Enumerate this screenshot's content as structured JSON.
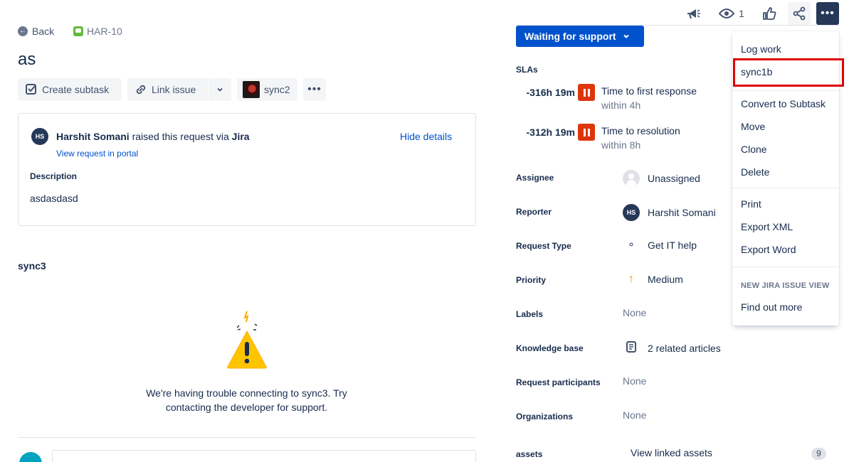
{
  "breadcrumb": {
    "back_label": "Back",
    "issue_key": "HAR-10"
  },
  "issue": {
    "title": "as"
  },
  "toolbar": {
    "create_subtask": "Create subtask",
    "link_issue": "Link issue",
    "app_label": "sync2"
  },
  "request": {
    "reporter_name": "Harshit Somani",
    "raised_text": "raised this request via",
    "channel": "Jira",
    "hide_details": "Hide details",
    "view_portal": "View request in portal",
    "description_label": "Description",
    "description": "asdasdasd",
    "avatar_initials": "HS"
  },
  "app_panel": {
    "title": "sync3",
    "error_line1": "We're having trouble connecting to sync3. Try",
    "error_line2": "contacting the developer for support."
  },
  "header": {
    "watchers": "1"
  },
  "status": {
    "label": "Waiting for support"
  },
  "slas": {
    "title": "SLAs",
    "items": [
      {
        "time": "-316h 19m",
        "name": "Time to first response",
        "goal": "within 4h"
      },
      {
        "time": "-312h 19m",
        "name": "Time to resolution",
        "goal": "within 8h"
      }
    ]
  },
  "fields": {
    "assignee_label": "Assignee",
    "assignee": "Unassigned",
    "reporter_label": "Reporter",
    "reporter": "Harshit Somani",
    "request_type_label": "Request Type",
    "request_type": "Get IT help",
    "priority_label": "Priority",
    "priority": "Medium",
    "labels_label": "Labels",
    "labels": "None",
    "kb_label": "Knowledge base",
    "kb": "2 related articles",
    "participants_label": "Request participants",
    "participants": "None",
    "orgs_label": "Organizations",
    "orgs": "None",
    "assets_label": "assets",
    "assets": "View linked assets",
    "assets_count": "9"
  },
  "menu": {
    "log_work": "Log work",
    "sync1b": "sync1b",
    "convert": "Convert to Subtask",
    "move": "Move",
    "clone": "Clone",
    "delete": "Delete",
    "print": "Print",
    "export_xml": "Export XML",
    "export_word": "Export Word",
    "group_label": "NEW JIRA ISSUE VIEW",
    "find_out": "Find out more"
  },
  "colors": {
    "primary": "#0052cc",
    "highlight": "#e00000",
    "sla_breach": "#de350b",
    "priority_medium": "#ff8b00"
  }
}
